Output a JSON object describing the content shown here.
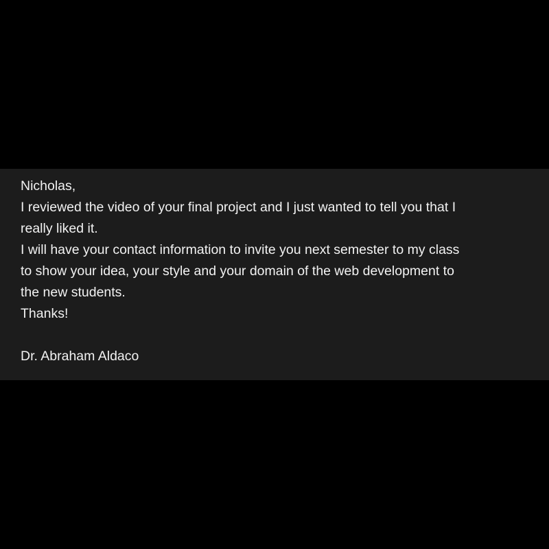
{
  "message": {
    "greeting": "Nicholas,",
    "body_lines": [
      "I reviewed the video of your final project and I just wanted to tell you that I",
      "really liked it.",
      "I will have your contact information to invite you next semester to my class",
      "to show your idea, your style and your domain of the web development to",
      "the new students.",
      "Thanks!"
    ],
    "signature": "Dr. Abraham Aldaco"
  },
  "colors": {
    "page_background": "#000000",
    "panel_background": "#1c1c1c",
    "text": "#f2f2f2"
  }
}
